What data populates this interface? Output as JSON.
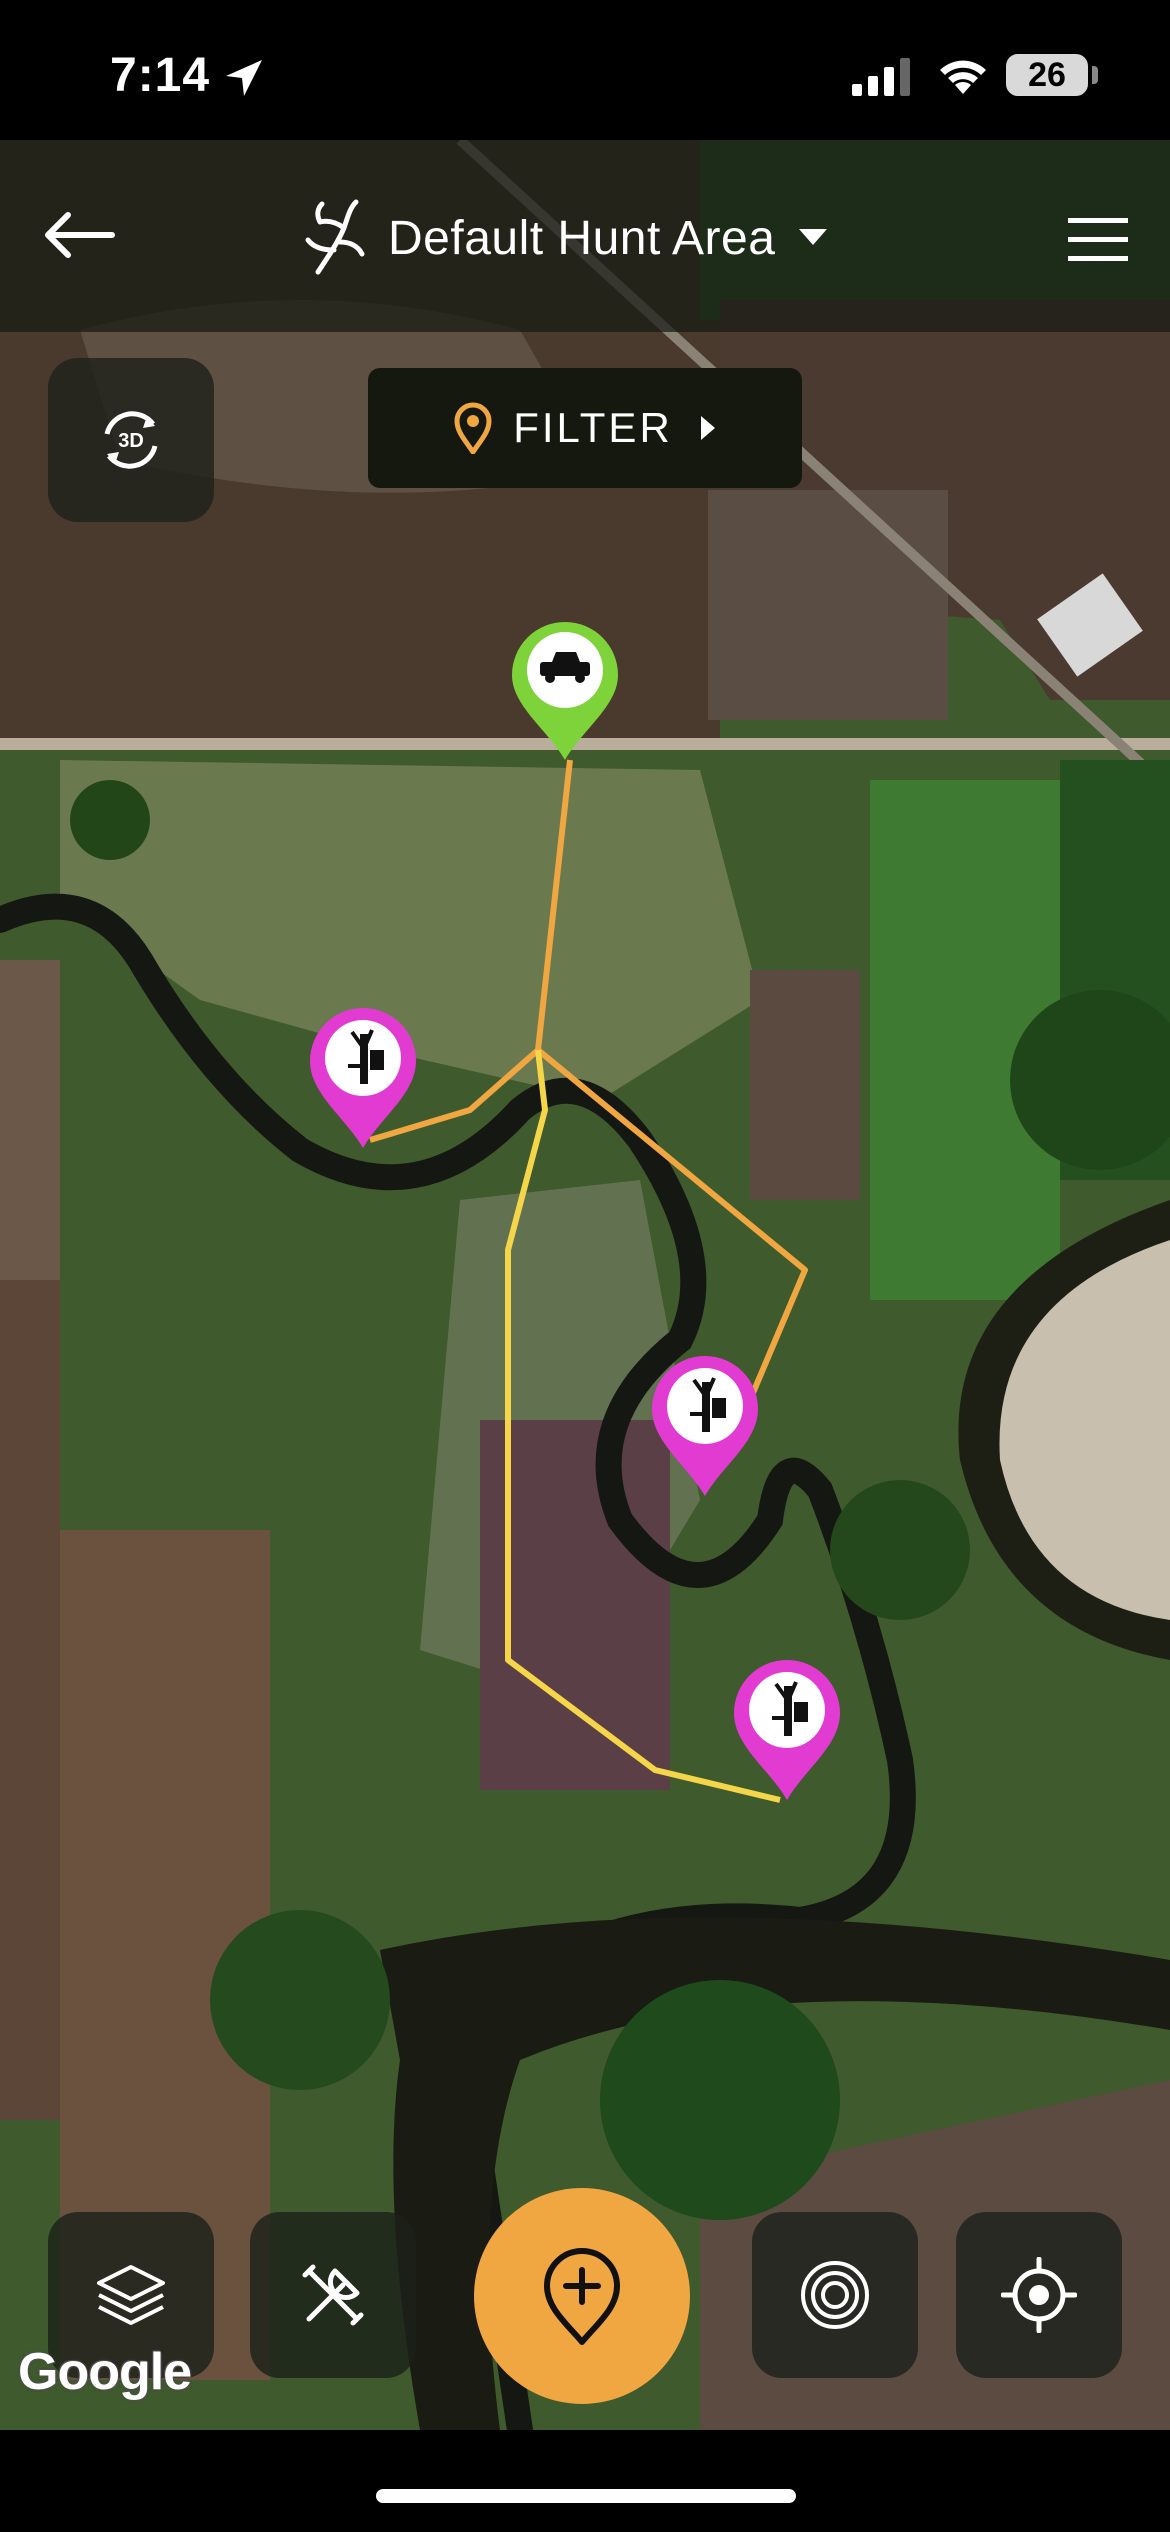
{
  "status_bar": {
    "time": "7:14",
    "battery": "26"
  },
  "header": {
    "title": "Default Hunt Area",
    "back_icon": "arrow-left-icon",
    "menu_icon": "hamburger-menu-icon",
    "brand_icon": "antler-logo-icon"
  },
  "controls": {
    "three_d_label": "3D",
    "filter_label": "FILTER"
  },
  "map": {
    "attribution": "Google",
    "pins": [
      {
        "type": "vehicle-parking",
        "color": "#7ed23a"
      },
      {
        "type": "treestand",
        "color": "#e23bd2"
      },
      {
        "type": "treestand",
        "color": "#e23bd2"
      },
      {
        "type": "treestand",
        "color": "#e23bd2"
      }
    ],
    "routes": [
      {
        "color": "#f0a641"
      },
      {
        "color": "#f5d64a"
      }
    ]
  },
  "bottom_toolbar": {
    "items": [
      "layers-icon",
      "tools-icon",
      "add-pin-icon",
      "range-rings-icon",
      "locate-icon"
    ]
  },
  "colors": {
    "accent": "#f0a641",
    "pin_stand": "#e23bd2",
    "pin_vehicle": "#7ed23a"
  }
}
